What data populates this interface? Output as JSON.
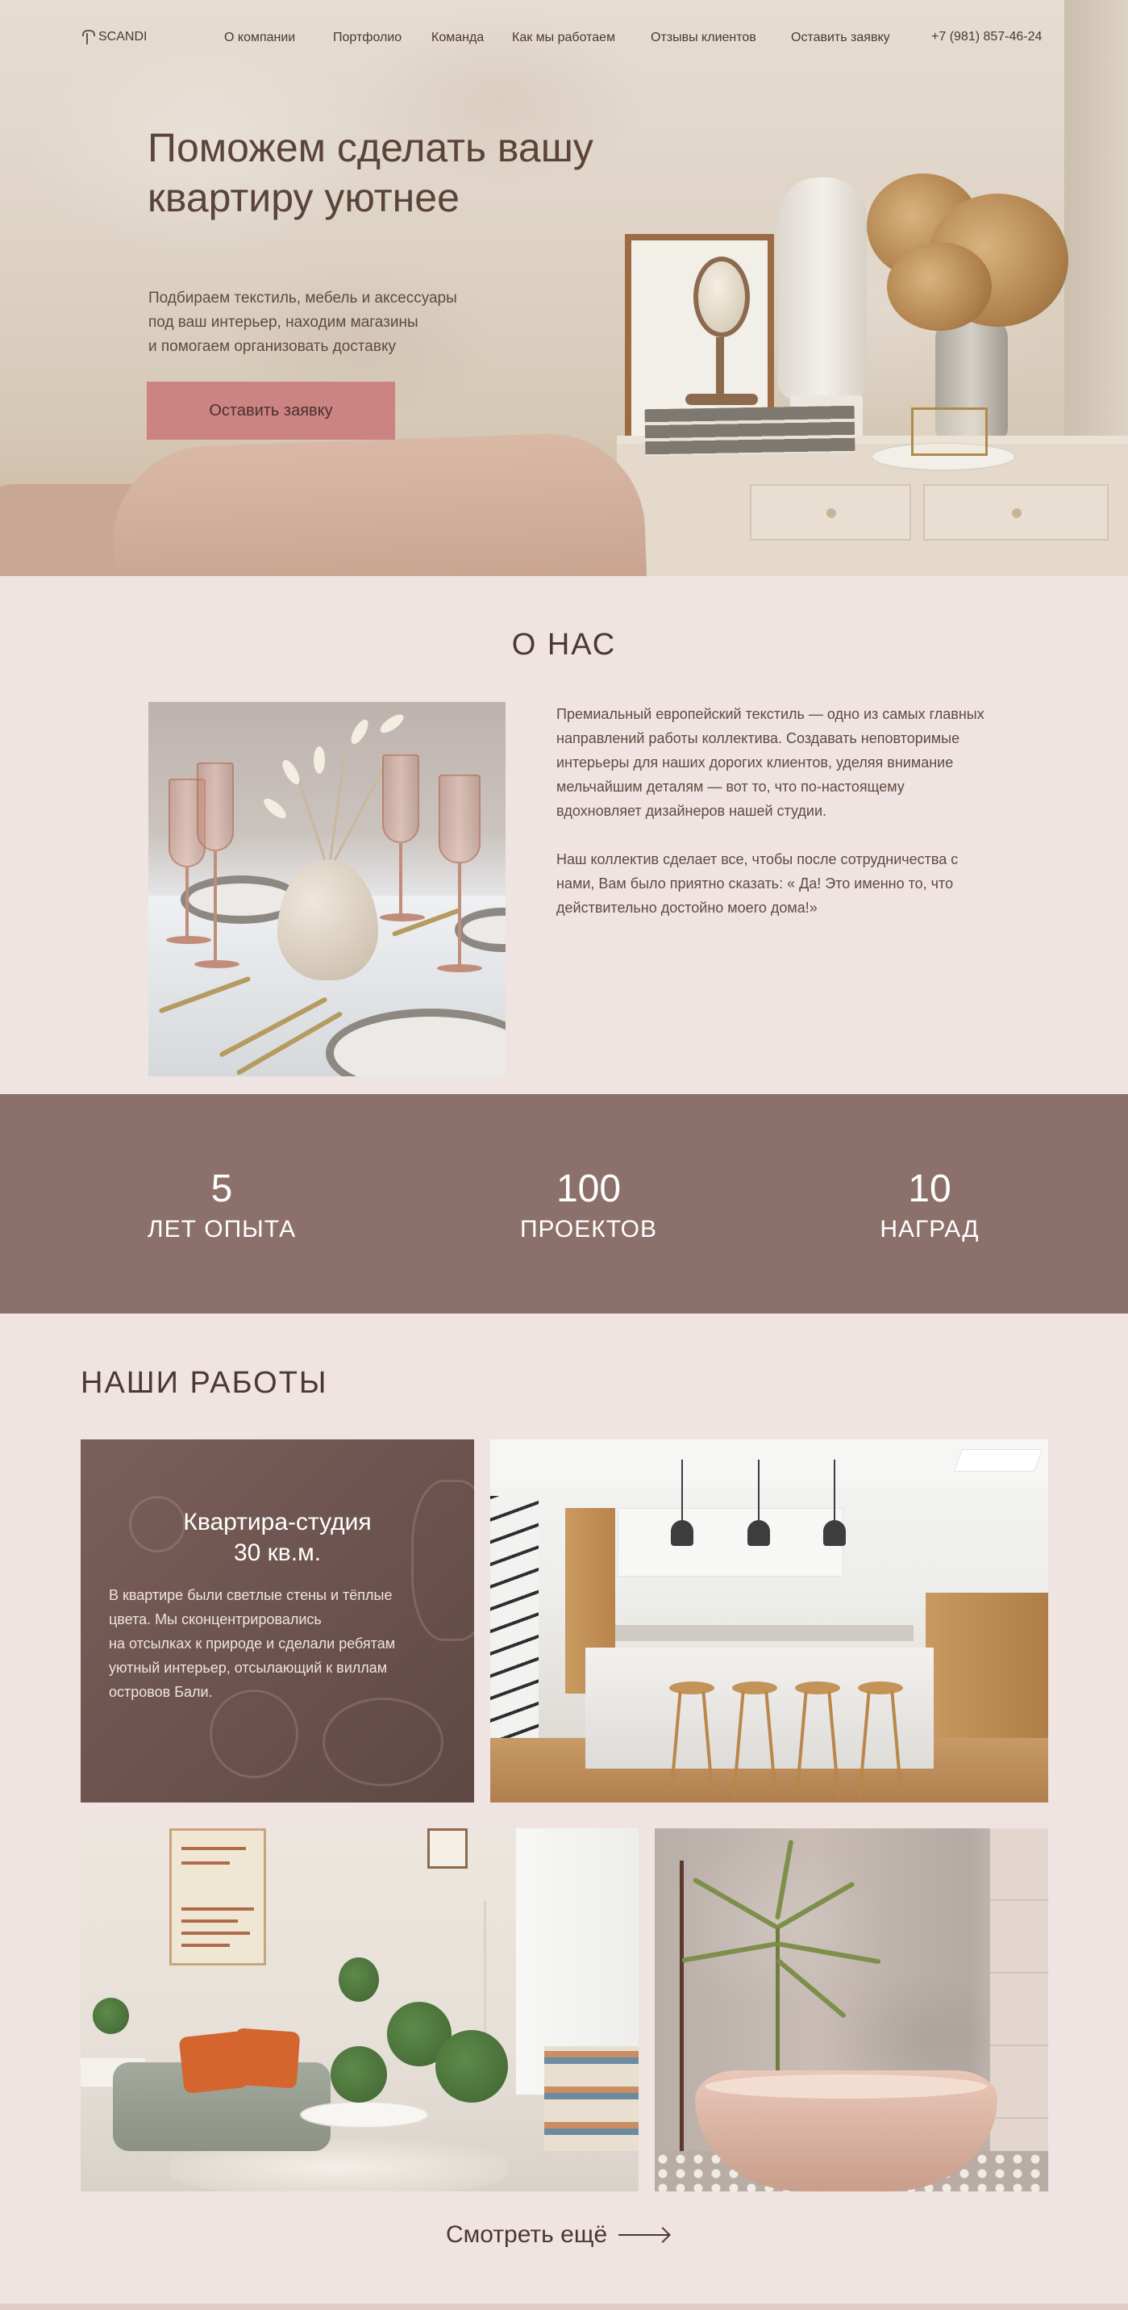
{
  "header": {
    "logo": "SCANDI",
    "nav": [
      "О компании",
      "Портфолио",
      "Команда",
      "Как мы работаем",
      "Отзывы клиентов",
      "Оставить заявку"
    ],
    "phone": "+7 (981) 857-46-24"
  },
  "hero": {
    "title": "Поможем сделать вашу квартиру уютнее",
    "text": "Подбираем текстиль, мебель и аксессуары\nпод ваш интерьер, находим магазины\nи помогаем организовать доставку",
    "button": "Оставить заявку"
  },
  "about": {
    "title": "О НАС",
    "paragraph1": "Премиальный европейский текстиль — одно из самых главных направлений работы коллектива. Создавать неповторимые интерьеры для наших дорогих клиентов, уделяя внимание мельчайшим деталям — вот то,  что по-настоящему вдохновляет дизайнеров нашей студии.",
    "paragraph2": "Наш коллектив сделает все, чтобы после сотрудничества с нами,  Вам было приятно сказать: « Да! Это именно то, что действительно достойно моего дома!»"
  },
  "stats": [
    {
      "number": "5",
      "label": "ЛЕТ ОПЫТА"
    },
    {
      "number": "100",
      "label": "ПРОЕКТОВ"
    },
    {
      "number": "10",
      "label": "НАГРАД"
    }
  ],
  "works": {
    "title": "НАШИ РАБОТЫ",
    "studio": {
      "title_line1": "Квартира-студия",
      "title_line2": "30 кв.м.",
      "text": "В квартире были светлые стены и тёплые\nцвета. Мы сконцентрировались\nна отсылках к природе и сделали ребятам\nуютный интерьер, отсылающий к виллам\nостровов Бали."
    },
    "more": "Смотреть ещё"
  },
  "colors": {
    "background": "#efe4e1",
    "accent_button": "#cb8482",
    "stats_band": "#8c706c",
    "text": "#4b3833"
  },
  "icons": {
    "logo": "lamp-icon",
    "more": "arrow-right-icon"
  }
}
